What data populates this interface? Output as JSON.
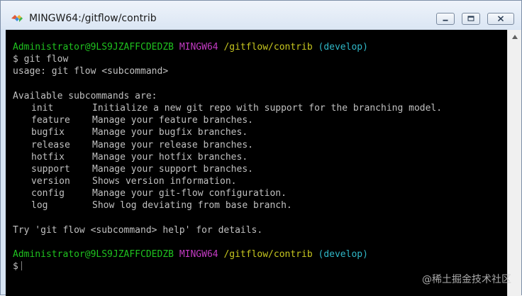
{
  "window": {
    "title": "MINGW64:/gitflow/contrib",
    "icon": "git-bash-icon",
    "buttons": {
      "minimize": "minimize-icon",
      "maximize": "maximize-icon",
      "close": "close-icon"
    }
  },
  "prompt": {
    "user_host": "Administrator@9LS9JZAFFCDEDZB",
    "system": "MINGW64",
    "path": "/gitflow/contrib",
    "branch": "(develop)",
    "symbol": "$"
  },
  "command": "git flow",
  "usage": "usage: git flow <subcommand>",
  "available_heading": "Available subcommands are:",
  "subcommands": [
    {
      "name": "init",
      "desc": "Initialize a new git repo with support for the branching model."
    },
    {
      "name": "feature",
      "desc": "Manage your feature branches."
    },
    {
      "name": "bugfix",
      "desc": "Manage your bugfix branches."
    },
    {
      "name": "release",
      "desc": "Manage your release branches."
    },
    {
      "name": "hotfix",
      "desc": "Manage your hotfix branches."
    },
    {
      "name": "support",
      "desc": "Manage your support branches."
    },
    {
      "name": "version",
      "desc": "Shows version information."
    },
    {
      "name": "config",
      "desc": "Manage your git-flow configuration."
    },
    {
      "name": "log",
      "desc": "Show log deviating from base branch."
    }
  ],
  "help_hint": "Try 'git flow <subcommand> help' for details.",
  "watermark": "@稀土掘金技术社区",
  "colors": {
    "prompt_user": "#1fc31f",
    "prompt_system": "#c33bc3",
    "prompt_path": "#c7c71f",
    "prompt_branch": "#2fb7c7",
    "text": "#c0c0c0",
    "background": "#000000"
  }
}
